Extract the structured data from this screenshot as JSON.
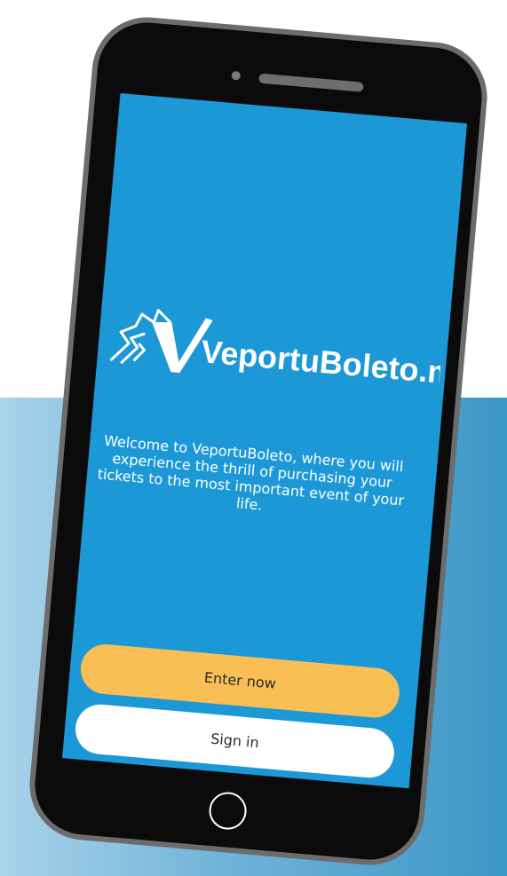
{
  "app": {
    "brand_name": "VeportuBoleto.mx",
    "brand_colors": {
      "screen_blue": "#1c98d6",
      "primary_button": "#f9bf55",
      "secondary_button": "#ffffff"
    }
  },
  "screen": {
    "welcome_text": "Welcome to VeportuBoleto, where you will experience the thrill of purchasing your tickets to the most important event of your life.",
    "enter_button_label": "Enter now",
    "signin_button_label": "Sign in"
  },
  "icons": {
    "logo": "ticket-logo-icon",
    "home": "home-button-icon"
  }
}
